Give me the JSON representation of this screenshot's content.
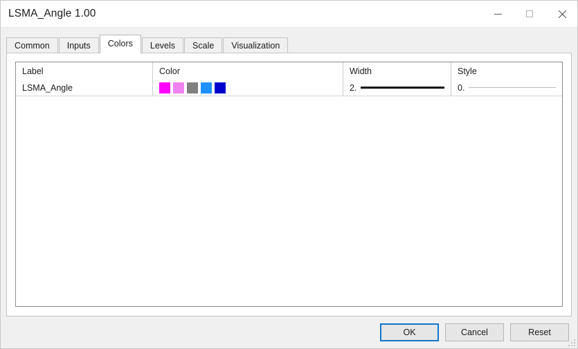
{
  "window": {
    "title": "LSMA_Angle 1.00",
    "controls": {
      "minimize": "minimize",
      "maximize": "maximize",
      "close": "close"
    }
  },
  "tabs": [
    {
      "label": "Common",
      "active": false
    },
    {
      "label": "Inputs",
      "active": false
    },
    {
      "label": "Colors",
      "active": true
    },
    {
      "label": "Levels",
      "active": false
    },
    {
      "label": "Scale",
      "active": false
    },
    {
      "label": "Visualization",
      "active": false
    }
  ],
  "table": {
    "headers": {
      "label": "Label",
      "color": "Color",
      "width": "Width",
      "style": "Style"
    },
    "rows": [
      {
        "label": "LSMA_Angle",
        "colors": [
          "#FF00FF",
          "#EE82EE",
          "#808080",
          "#1E90FF",
          "#0000CD"
        ],
        "width_value": "2.",
        "style_value": "0."
      }
    ]
  },
  "footer": {
    "ok": "OK",
    "cancel": "Cancel",
    "reset": "Reset"
  },
  "theme": {
    "accent": "#1176c8",
    "window_bg": "#f0f0f0",
    "panel_bg": "#ffffff"
  }
}
